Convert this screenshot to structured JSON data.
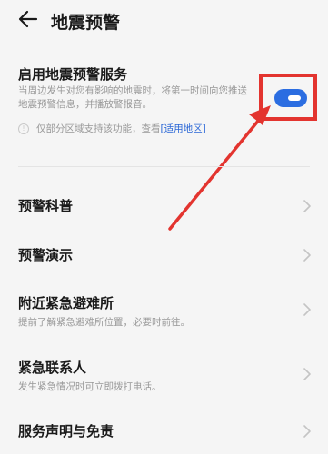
{
  "header": {
    "title": "地震预警"
  },
  "service": {
    "title": "启用地震预警服务",
    "desc": "当周边发生对您有影响的地震时，将第一时间向您推送地震预警信息，并播放警报音。",
    "toggle_on": true,
    "tip_prefix": "仅部分区域支持该功能，查看",
    "tip_link": "[适用地区]"
  },
  "menu": [
    {
      "label": "预警科普",
      "sub": ""
    },
    {
      "label": "预警演示",
      "sub": ""
    },
    {
      "label": "附近紧急避难所",
      "sub": "提前了解紧急避难所位置，必要时前往。"
    },
    {
      "label": "紧急联系人",
      "sub": "发生紧急情况时可立即拨打电话。"
    },
    {
      "label": "服务声明与免责",
      "sub": ""
    }
  ],
  "colors": {
    "accent": "#2b6de1",
    "highlight": "#e3342f",
    "link": "#2966d6"
  }
}
